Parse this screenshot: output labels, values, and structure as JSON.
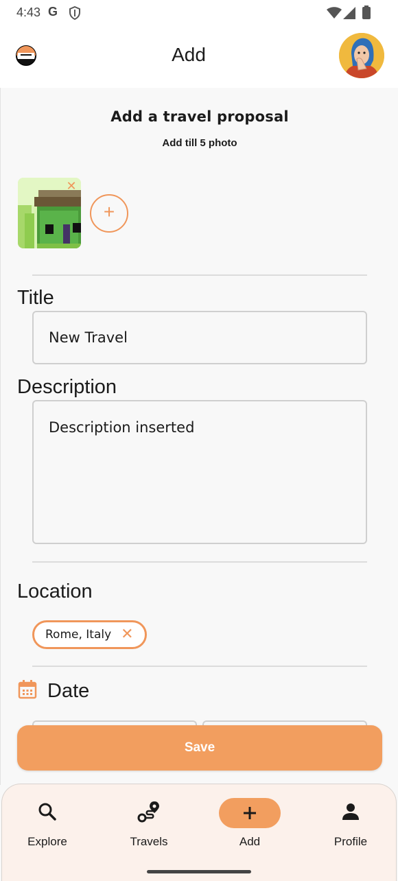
{
  "status": {
    "time": "4:43",
    "g_icon": "G"
  },
  "header": {
    "title": "Add",
    "logo": "app-logo-icon",
    "avatar": "user-avatar"
  },
  "form": {
    "heading": "Add a travel proposal",
    "subheading": "Add till 5 photo",
    "photos": [
      {
        "name": "pixel-house-photo",
        "remove_icon": "close-icon"
      }
    ],
    "add_photo_icon": "+",
    "photo_remove_glyph": "✕",
    "title_label": "Title",
    "title_value": "New Travel",
    "description_label": "Description",
    "description_value": "Description inserted",
    "location_label": "Location",
    "location_chip": "Rome, Italy",
    "chip_remove_glyph": "✕",
    "date_label": "Date",
    "save_label": "Save"
  },
  "bottom_nav": [
    {
      "label": "Explore",
      "icon": "search-icon"
    },
    {
      "label": "Travels",
      "icon": "route-icon"
    },
    {
      "label": "Add",
      "icon": "plus-icon",
      "active": true
    },
    {
      "label": "Profile",
      "icon": "person-icon"
    }
  ],
  "colors": {
    "accent": "#f29e5f",
    "accent_border": "#f0965a",
    "nav_bg": "#fcf1eb",
    "background": "#f8f8f8"
  }
}
